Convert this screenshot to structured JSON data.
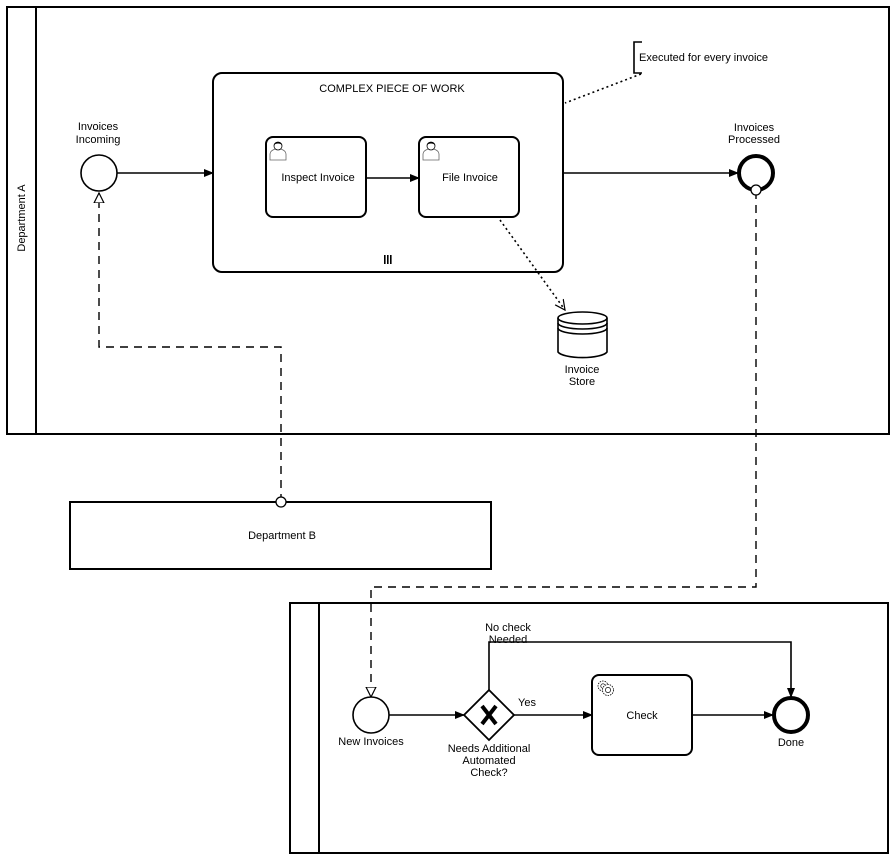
{
  "diagram": {
    "type": "BPMN collaboration",
    "pools": {
      "department_a": {
        "label": "Department A"
      },
      "department_b": {
        "label": "Department B"
      },
      "lower_pool": {
        "label": ""
      }
    },
    "department_a": {
      "start_event": {
        "label_line1": "Invoices",
        "label_line2": "Incoming",
        "kind": "message-start-event"
      },
      "subprocess": {
        "label": "COMPLEX PIECE OF WORK",
        "marker": "parallel-multi-instance",
        "marker_glyph": "III"
      },
      "tasks": [
        {
          "label": "Inspect Invoice",
          "icon": "user-icon"
        },
        {
          "label": "File Invoice",
          "icon": "user-icon"
        }
      ],
      "annotation": {
        "text": "Executed for every invoice"
      },
      "data_store": {
        "label_line1": "Invoice",
        "label_line2": "Store"
      },
      "end_event": {
        "label_line1": "Invoices",
        "label_line2": "Processed",
        "kind": "message-end-event"
      }
    },
    "lower_pool": {
      "start_event": {
        "label": "New Invoices"
      },
      "gateway": {
        "label_line1": "Needs Additional",
        "label_line2": "Automated",
        "label_line3": "Check?",
        "glyph": "X"
      },
      "flows": {
        "no_check_line1": "No check",
        "no_check_line2": "Needed",
        "yes": "Yes"
      },
      "service_task": {
        "label": "Check",
        "icon": "gear-icon"
      },
      "end_event": {
        "label": "Done"
      }
    }
  }
}
